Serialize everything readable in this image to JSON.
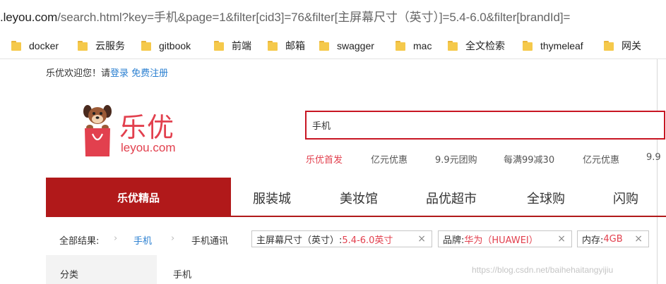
{
  "address_bar": {
    "host": ".leyou.com",
    "path": "/search.html?key=手机&page=1&filter[cid3]=76&filter[主屏幕尺寸（英寸）]=5.4-6.0&filter[brandId]="
  },
  "bookmarks": [
    "docker",
    "云服务",
    "gitbook",
    "前端",
    "邮箱",
    "swagger",
    "mac",
    "全文检索",
    "thymeleaf",
    "网关"
  ],
  "welcome": {
    "text": "乐优欢迎您！请",
    "login": "登录",
    "register": "免费注册"
  },
  "logo": {
    "cn": "乐优",
    "en": "leyou.com"
  },
  "search": {
    "value": "手机"
  },
  "hotwords": [
    "乐优首发",
    "亿元优惠",
    "9.9元团购",
    "每满99减30",
    "亿元优惠",
    "9.9"
  ],
  "nav": {
    "main": "乐优精品",
    "items": [
      "服装城",
      "美妆馆",
      "品优超市",
      "全球购",
      "闪购"
    ]
  },
  "breadcrumb": {
    "all": "全部结果:",
    "sep1": "›",
    "category": "手机",
    "sep2": "›",
    "sub": "手机通讯"
  },
  "filters": [
    {
      "label": "主屏幕尺寸（英寸）:",
      "value": "5.4-6.0英寸",
      "close": "×"
    },
    {
      "label": "品牌:",
      "value": "华为（HUAWEI）",
      "close": "×"
    },
    {
      "label": "内存:",
      "value": "4GB",
      "close": "×"
    }
  ],
  "category_row": {
    "label": "分类",
    "value": "手机"
  },
  "watermark": "https://blog.csdn.net/baihehaitangyijiu",
  "colors": {
    "brand_red": "#b1191a",
    "accent_red": "#e2404e",
    "link_blue": "#2a7fd1",
    "folder_yellow": "#f5c94b"
  }
}
